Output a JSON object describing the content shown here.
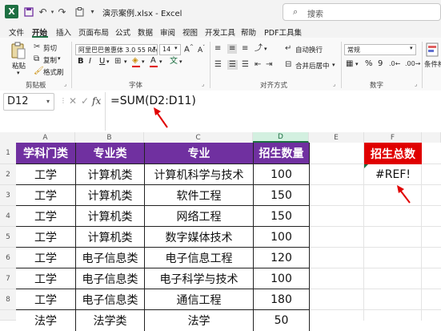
{
  "title_bar": {
    "app_logo": "X",
    "document_title": "演示案例.xlsx - Excel",
    "search_placeholder": "搜索",
    "icons": [
      "excel-logo-icon",
      "save-icon",
      "undo-icon",
      "redo-icon",
      "clipboard-icon",
      "more-icon"
    ]
  },
  "tabs": [
    "文件",
    "开始",
    "插入",
    "页面布局",
    "公式",
    "数据",
    "审阅",
    "视图",
    "开发工具",
    "帮助",
    "PDF工具集"
  ],
  "active_tab": "开始",
  "ribbon": {
    "clipboard": {
      "paste": "粘贴",
      "cut": "剪切",
      "copy": "复制",
      "format_painter": "格式刷",
      "label": "剪贴板"
    },
    "font": {
      "font_name": "阿里巴巴普惠体 3.0 55 Reg",
      "font_size": "14",
      "bold": "B",
      "italic": "I",
      "underline": "U",
      "label": "字体",
      "accent_color": "#e00000"
    },
    "alignment": {
      "wrap": "自动换行",
      "merge": "合并后居中",
      "label": "对齐方式"
    },
    "number": {
      "format": "常规",
      "label": "数字",
      "percent": "%",
      "comma": "9"
    },
    "styles": {
      "conditional": "条件格"
    }
  },
  "formula_bar": {
    "name_box": "D12",
    "fx": "fx",
    "formula": "=SUM(D2:D11)"
  },
  "grid": {
    "columns": [
      "A",
      "B",
      "C",
      "D",
      "E",
      "F"
    ],
    "selected_column": "D",
    "rows": [
      "1",
      "2",
      "3",
      "4",
      "5",
      "6",
      "7",
      "8"
    ],
    "header_row": [
      "学科门类",
      "专业类",
      "专业",
      "招生数量"
    ],
    "data_rows": [
      [
        "工学",
        "计算机类",
        "计算机科学与技术",
        "100"
      ],
      [
        "工学",
        "计算机类",
        "软件工程",
        "150"
      ],
      [
        "工学",
        "计算机类",
        "网络工程",
        "150"
      ],
      [
        "工学",
        "计算机类",
        "数字媒体技术",
        "100"
      ],
      [
        "工学",
        "电子信息类",
        "电子信息工程",
        "120"
      ],
      [
        "工学",
        "电子信息类",
        "电子科学与技术",
        "100"
      ],
      [
        "工学",
        "电子信息类",
        "通信工程",
        "180"
      ],
      [
        "法学",
        "法学类",
        "法学",
        "50"
      ]
    ],
    "f_header": "招生总数",
    "f_value": "#REF!",
    "header_color": "#7030a0",
    "total_header_color": "#e00000"
  }
}
